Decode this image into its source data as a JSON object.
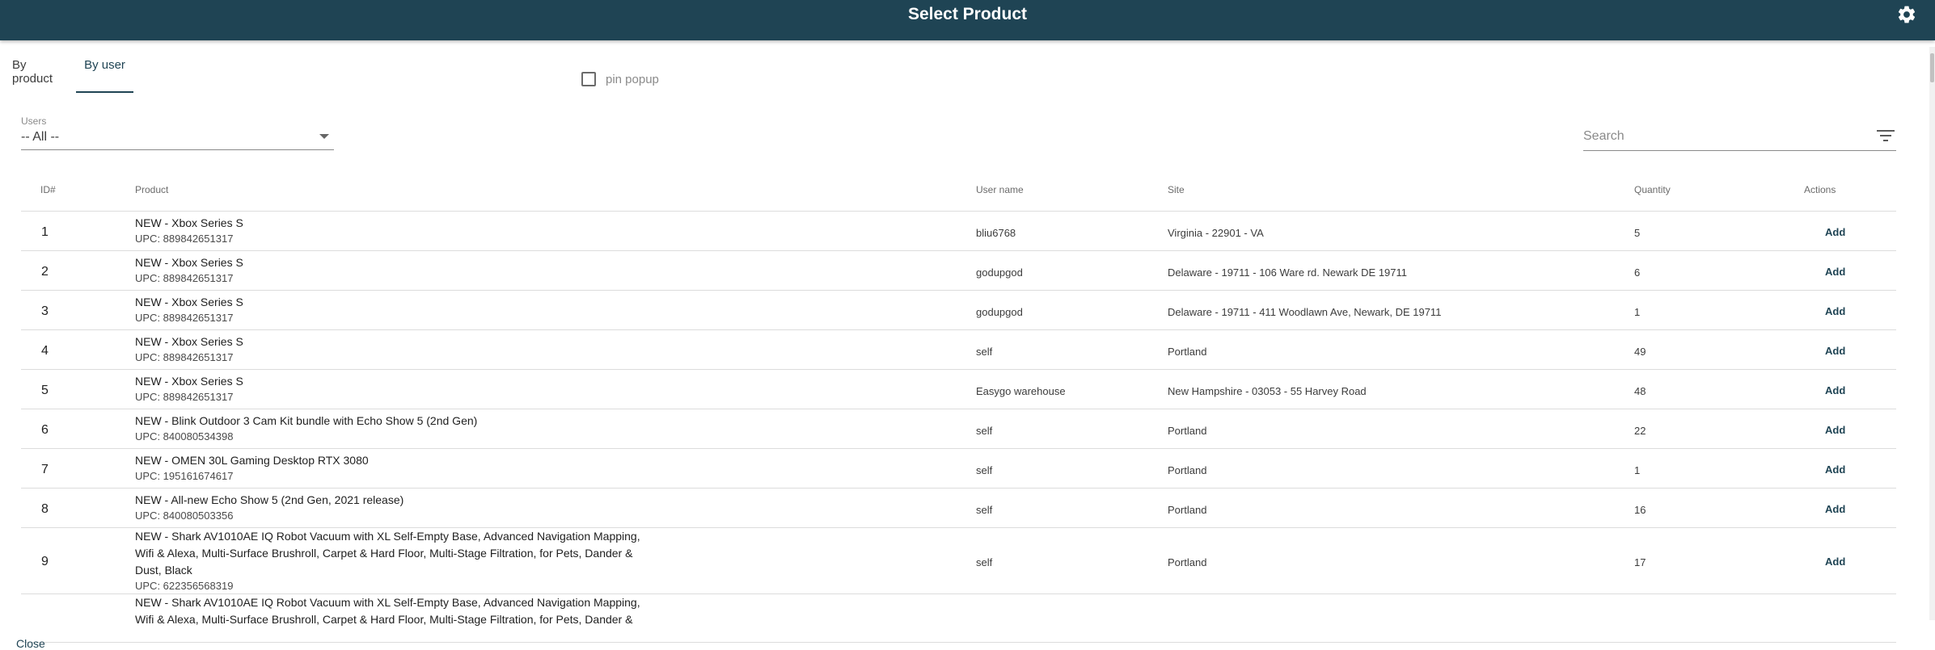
{
  "header": {
    "title": "Select Product",
    "settings_icon": "gear-icon"
  },
  "tabs": [
    {
      "label": "By product",
      "active": false
    },
    {
      "label": "By user",
      "active": true
    }
  ],
  "pin_popup": {
    "label": "pin popup",
    "checked": false
  },
  "users_filter": {
    "label": "Users",
    "value": "-- All --"
  },
  "search": {
    "placeholder": "Search",
    "value": ""
  },
  "table": {
    "columns": [
      "ID#",
      "Product",
      "User name",
      "Site",
      "Quantity",
      "Actions"
    ],
    "rows": [
      {
        "id": "1",
        "name": "NEW - Xbox Series S",
        "upc": "UPC: 889842651317",
        "user": "bliu6768",
        "site": "Virginia - 22901 - VA",
        "qty": "5",
        "action": "Add"
      },
      {
        "id": "2",
        "name": "NEW - Xbox Series S",
        "upc": "UPC: 889842651317",
        "user": "godupgod",
        "site": "Delaware - 19711 - 106 Ware rd. Newark DE 19711",
        "qty": "6",
        "action": "Add"
      },
      {
        "id": "3",
        "name": "NEW - Xbox Series S",
        "upc": "UPC: 889842651317",
        "user": "godupgod",
        "site": "Delaware - 19711 - 411 Woodlawn Ave, Newark, DE 19711",
        "qty": "1",
        "action": "Add"
      },
      {
        "id": "4",
        "name": "NEW - Xbox Series S",
        "upc": "UPC: 889842651317",
        "user": "self",
        "site": "Portland",
        "qty": "49",
        "action": "Add"
      },
      {
        "id": "5",
        "name": "NEW - Xbox Series S",
        "upc": "UPC: 889842651317",
        "user": "Easygo warehouse",
        "site": "New Hampshire - 03053 - 55 Harvey Road",
        "qty": "48",
        "action": "Add"
      },
      {
        "id": "6",
        "name": "NEW - Blink Outdoor 3 Cam Kit bundle with Echo Show 5 (2nd Gen)",
        "upc": "UPC: 840080534398",
        "user": "self",
        "site": "Portland",
        "qty": "22",
        "action": "Add"
      },
      {
        "id": "7",
        "name": "NEW - OMEN 30L Gaming Desktop RTX 3080",
        "upc": "UPC: 195161674617",
        "user": "self",
        "site": "Portland",
        "qty": "1",
        "action": "Add"
      },
      {
        "id": "8",
        "name": "NEW - All-new Echo Show 5 (2nd Gen, 2021 release)",
        "upc": "UPC: 840080503356",
        "user": "self",
        "site": "Portland",
        "qty": "16",
        "action": "Add"
      },
      {
        "id": "9",
        "name": "NEW - Shark AV1010AE IQ Robot Vacuum with XL Self-Empty Base, Advanced Navigation Mapping, Wifi & Alexa, Multi-Surface Brushroll, Carpet & Hard Floor, Multi-Stage Filtration, for Pets, Dander & Dust, Black",
        "upc": "UPC: 622356568319",
        "user": "self",
        "site": "Portland",
        "qty": "17",
        "action": "Add"
      },
      {
        "id": "",
        "name": "NEW - Shark AV1010AE IQ Robot Vacuum with XL Self-Empty Base, Advanced Navigation Mapping, Wifi & Alexa, Multi-Surface Brushroll, Carpet & Hard Floor, Multi-Stage Filtration, for Pets, Dander &",
        "upc": "",
        "user": "",
        "site": "",
        "qty": "",
        "action": ""
      }
    ]
  },
  "footer": {
    "close_label": "Close"
  }
}
